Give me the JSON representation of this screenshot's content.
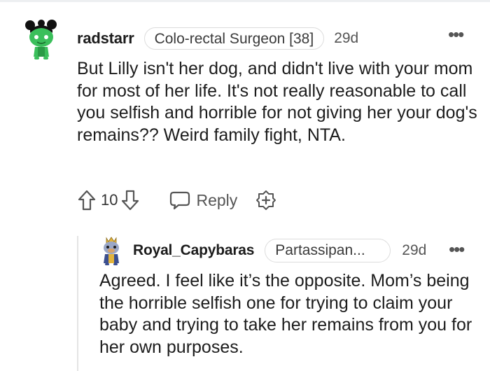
{
  "comments": [
    {
      "username": "radstarr",
      "flair": "Colo-rectal Surgeon [38]",
      "age": "29d",
      "body": "But Lilly isn't her dog, and didn't live with your mom for most of her life. It's not really reasonable to call you selfish and horrible for not giving her your dog's remains?? Weird family fight, NTA.",
      "vote_count": "10",
      "reply_label": "Reply",
      "more_label": "•••",
      "avatar_color": "#3bbf5b"
    },
    {
      "username": "Royal_Capybaras",
      "flair": "Partassipan...",
      "age": "29d",
      "body": "Agreed. I feel like it’s the opposite. Mom’s being the horrible selfish one for trying to claim your baby and trying to take her remains from you for her own purposes.",
      "more_label": "•••",
      "avatar_color": "#d8a36a"
    }
  ],
  "icons": {
    "upvote": "upvote-arrow-icon",
    "downvote": "downvote-arrow-icon",
    "reply": "speech-bubble-icon",
    "award": "award-plus-icon"
  },
  "colors": {
    "text": "#1c1c1c",
    "meta": "#555555",
    "flair_border": "#dcdcdc",
    "thread_line": "#e4e4e4"
  }
}
